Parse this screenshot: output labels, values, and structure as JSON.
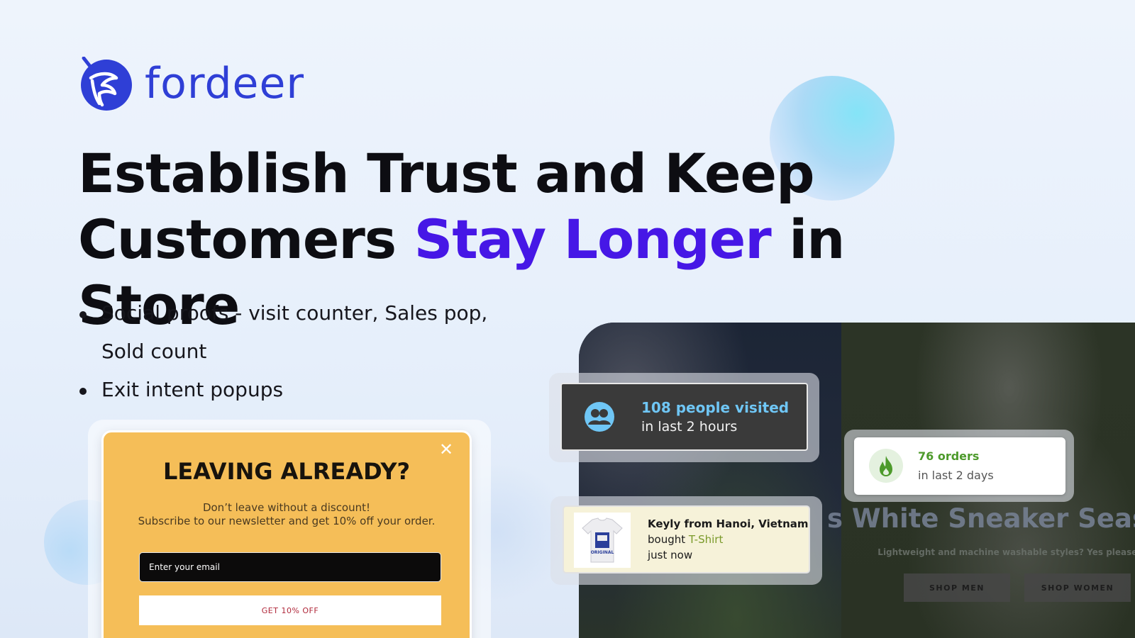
{
  "brand": {
    "name": "fordeer",
    "logo_icon": "deer-antler-icon",
    "color": "#2f3fd6"
  },
  "headline": {
    "line1": "Establish Trust and Keep",
    "line2_start": "Customers ",
    "line2_accent": "Stay Longer",
    "line2_end": " in Store",
    "accent_color": "#4617e6"
  },
  "bullets": [
    "Social proofs - visit counter, Sales pop, Sold count",
    "Exit intent popups"
  ],
  "exit_popup": {
    "title": "LEAVING ALREADY?",
    "subtitle_line1": "Don’t leave without a discount!",
    "subtitle_line2": "Subscribe to our newsletter and get 10% off your order.",
    "email_placeholder": "Enter your email",
    "button_label": "GET 10% OFF",
    "close_icon": "close-icon",
    "background": "#f5be58"
  },
  "store_preview": {
    "heading": "s White Sneaker Season",
    "subheading": "Lightweight and machine washable styles? Yes please.",
    "shop_men": "SHOP MEN",
    "shop_women": "SHOP WOMEN"
  },
  "visit_counter": {
    "line1": "108 people visited",
    "line2": "in last 2 hours",
    "icon": "users-icon"
  },
  "sold_count": {
    "line1": "76 orders",
    "line2": "in last 2 days",
    "icon": "fire-icon"
  },
  "sales_pop": {
    "line1": "Keyly from Hanoi, Vietnam",
    "bought": "bought ",
    "product": "T-Shirt",
    "line3": "just now",
    "thumb_icon": "tshirt-icon",
    "thumb_text": "ORIGINAL"
  }
}
